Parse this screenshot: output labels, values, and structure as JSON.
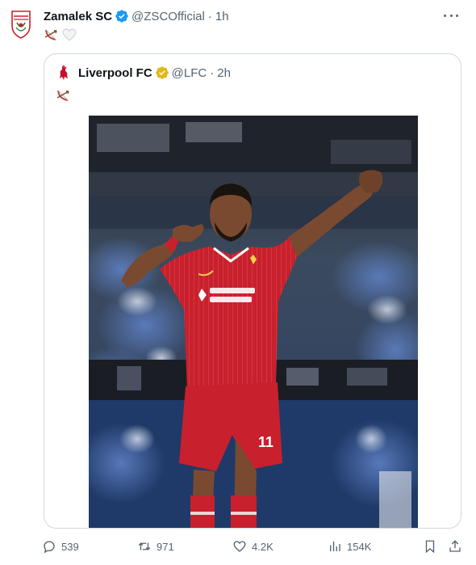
{
  "tweet": {
    "author_name": "Zamalek SC",
    "author_handle": "@ZSCOfficial",
    "separator": "·",
    "time": "1h",
    "icons": [
      "zamalek-crest-icon",
      "verified-badge-icon",
      "more-options-icon",
      "bow-arrow-emoji",
      "white-heart-emoji"
    ]
  },
  "quoted": {
    "author_name": "Liverpool FC",
    "author_handle": "@LFC",
    "separator": "·",
    "time": "2h",
    "icons": [
      "liverbird-crest-icon",
      "gold-verified-badge-icon",
      "bow-arrow-emoji"
    ],
    "photo": {
      "jersey_sponsor": "standard chartered",
      "shirt_number": "11",
      "colors": {
        "kit_red": "#c8202c",
        "crowd_blue": "#2a4f8f"
      }
    }
  },
  "actions": {
    "replies": "539",
    "reposts": "971",
    "likes": "4.2K",
    "views": "154K"
  },
  "colors": {
    "text_primary": "#0f1419",
    "text_secondary": "#536471",
    "border": "#cfd9de",
    "verified_blue": "#1d9bf0",
    "verified_gold": "#e2b719"
  }
}
